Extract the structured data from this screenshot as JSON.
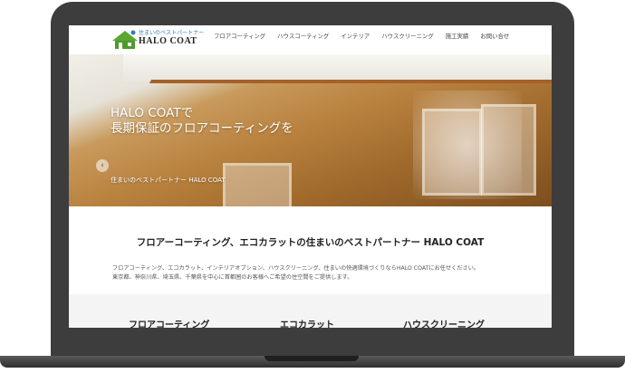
{
  "header": {
    "logo_tagline": "住まいのベストパートナー",
    "logo_name": "HALO COAT",
    "nav": [
      "フロアコーティング",
      "ハウスコーティング",
      "インテリア",
      "ハウスクリーニング",
      "施工実績",
      "お問い合せ"
    ]
  },
  "hero": {
    "title_line1": "HALO COATで",
    "title_line2": "長期保証のフロアコーティングを",
    "subtitle": "住まいのベストパートナー HALO COAT",
    "prev_arrow": "‹",
    "slide_count": 3,
    "active_slide": 1
  },
  "main": {
    "headline": "フロアーコーティング、エコカラットの住まいのベストパートナー HALO COAT",
    "desc_line1": "フロアコーティング、エコカラット、インテリアオプション、ハウスクリーニング、住まいの快適環境づくりならHALO COATにお任せください。",
    "desc_line2": "東京都、神奈川県、埼玉県、千葉県を中心に首都圏のお客様へご希望の住空間をご提供します。"
  },
  "services": [
    "フロアコーティング",
    "エコカラット",
    "ハウスクリーニング"
  ],
  "colors": {
    "frame": "#3d3d3d",
    "logo_green": "#5aa832",
    "logo_blue": "#2a7fb8"
  }
}
